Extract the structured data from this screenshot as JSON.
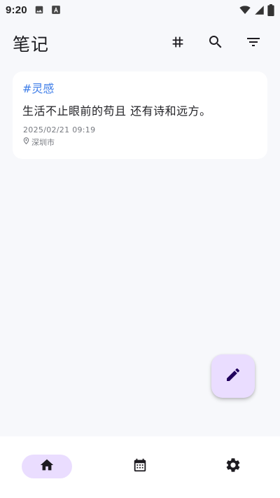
{
  "status_bar": {
    "time": "9:20",
    "icons": [
      "image-icon",
      "font-icon",
      "wifi-icon",
      "signal-icon",
      "battery-icon"
    ]
  },
  "header": {
    "title": "笔记",
    "actions": [
      "hashtag-icon",
      "search-icon",
      "filter-icon"
    ]
  },
  "notes": [
    {
      "tag": "#灵感",
      "content": "生活不止眼前的苟且 还有诗和远方。",
      "date": "2025/02/21 09:19",
      "location": "深圳市"
    }
  ],
  "fab": {
    "icon": "pencil-icon"
  },
  "bottom_nav": {
    "items": [
      {
        "icon": "home-icon",
        "active": true
      },
      {
        "icon": "calendar-icon",
        "active": false
      },
      {
        "icon": "settings-icon",
        "active": false
      }
    ]
  },
  "colors": {
    "background": "#f7f8fb",
    "accent_tag": "#3f7ee8",
    "active_pill": "#eaddff",
    "icon_dark": "#1d1b20"
  }
}
